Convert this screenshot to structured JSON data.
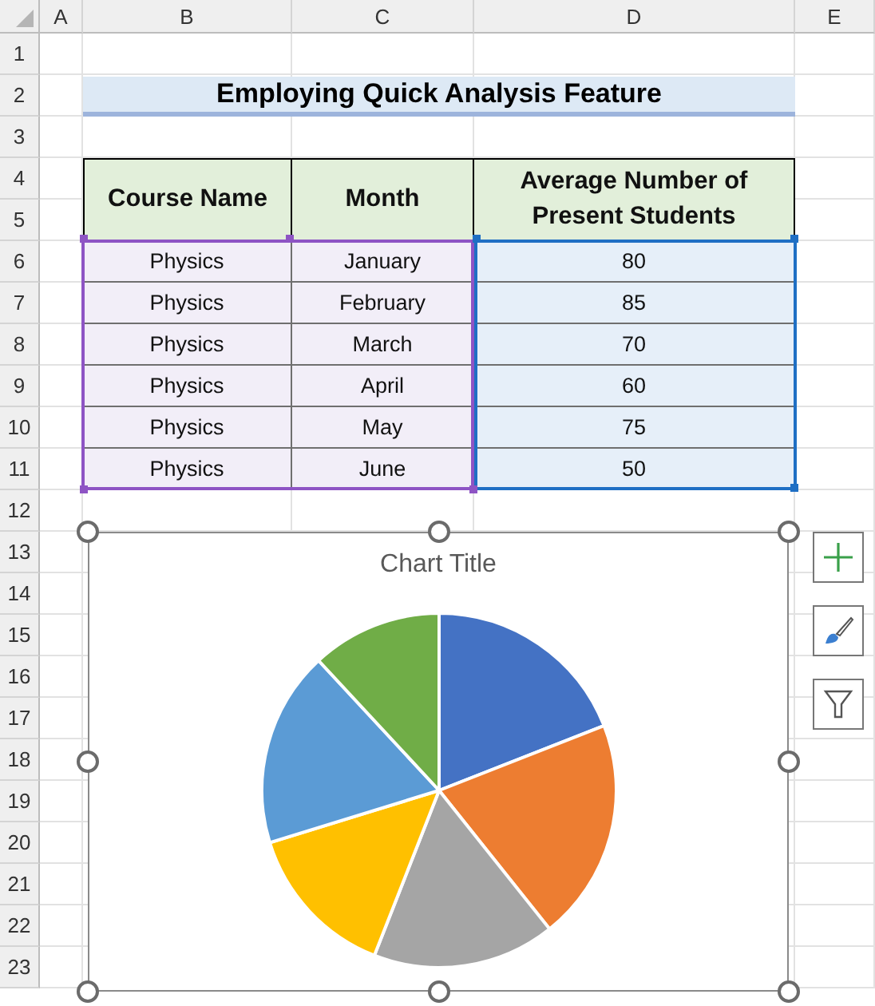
{
  "column_headers": [
    "A",
    "B",
    "C",
    "D",
    "E"
  ],
  "row_headers": [
    "1",
    "2",
    "3",
    "4",
    "5",
    "6",
    "7",
    "8",
    "9",
    "10",
    "11",
    "12",
    "13",
    "14",
    "15",
    "16",
    "17",
    "18",
    "19",
    "20",
    "21",
    "22",
    "23"
  ],
  "title": "Employing Quick Analysis Feature",
  "table": {
    "columns": [
      "Course Name",
      "Month",
      "Average Number of Present Students"
    ],
    "rows": [
      [
        "Physics",
        "January",
        "80"
      ],
      [
        "Physics",
        "February",
        "85"
      ],
      [
        "Physics",
        "March",
        "70"
      ],
      [
        "Physics",
        "April",
        "60"
      ],
      [
        "Physics",
        "May",
        "75"
      ],
      [
        "Physics",
        "June",
        "50"
      ]
    ]
  },
  "chart": {
    "title": "Chart Title",
    "slices": [
      {
        "color": "#4472c4"
      },
      {
        "color": "#ed7d31"
      },
      {
        "color": "#a5a5a5"
      },
      {
        "color": "#ffc000"
      },
      {
        "color": "#5b9bd5"
      },
      {
        "color": "#70ad47"
      }
    ]
  }
}
